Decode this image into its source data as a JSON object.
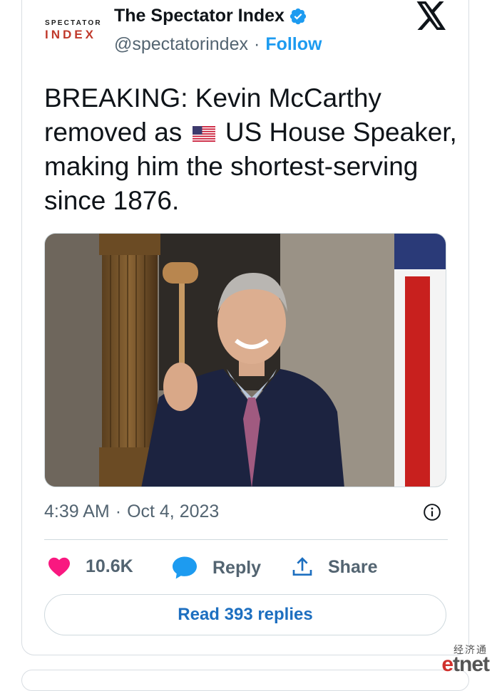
{
  "account": {
    "logo_line1": "SPECTATOR",
    "logo_line2": "INDEX",
    "display_name": "The Spectator Index",
    "handle": "@spectatorindex",
    "separator": "·",
    "follow_label": "Follow",
    "verified_icon": "verified-badge-icon",
    "brand_color": "#1d9bf0"
  },
  "platform": {
    "logo_icon": "x-logo-icon"
  },
  "tweet": {
    "text_part1": "BREAKING: Kevin McCarthy removed as",
    "flag_icon": "us-flag-icon",
    "text_part2": "US House Speaker, making him the shortest-serving since 1876.",
    "media_icon": "photo-man-holding-gavel"
  },
  "meta": {
    "time": "4:39 AM",
    "separator": "·",
    "date": "Oct 4, 2023",
    "info_icon": "info-icon"
  },
  "actions": {
    "like_count": "10.6K",
    "like_icon": "heart-icon",
    "like_color": "#f91880",
    "reply_label": "Reply",
    "reply_icon": "speech-bubble-icon",
    "share_label": "Share",
    "share_icon": "share-upload-icon"
  },
  "read_replies_label": "Read 393 replies",
  "watermark": {
    "cn": "经济通",
    "en_prefix": "e",
    "en_rest": "tnet"
  }
}
